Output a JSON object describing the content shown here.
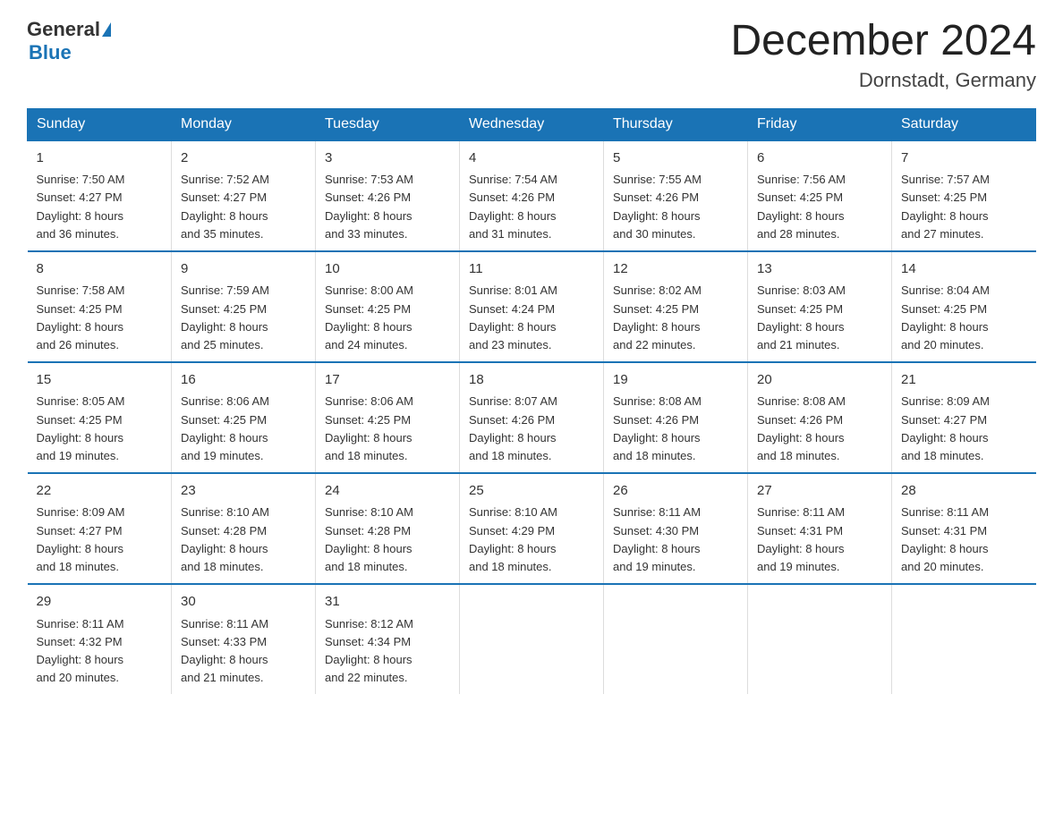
{
  "header": {
    "logo_general": "General",
    "logo_blue": "Blue",
    "month_title": "December 2024",
    "location": "Dornstadt, Germany"
  },
  "columns": [
    "Sunday",
    "Monday",
    "Tuesday",
    "Wednesday",
    "Thursday",
    "Friday",
    "Saturday"
  ],
  "weeks": [
    [
      {
        "day": "1",
        "sunrise": "7:50 AM",
        "sunset": "4:27 PM",
        "daylight": "8 hours and 36 minutes."
      },
      {
        "day": "2",
        "sunrise": "7:52 AM",
        "sunset": "4:27 PM",
        "daylight": "8 hours and 35 minutes."
      },
      {
        "day": "3",
        "sunrise": "7:53 AM",
        "sunset": "4:26 PM",
        "daylight": "8 hours and 33 minutes."
      },
      {
        "day": "4",
        "sunrise": "7:54 AM",
        "sunset": "4:26 PM",
        "daylight": "8 hours and 31 minutes."
      },
      {
        "day": "5",
        "sunrise": "7:55 AM",
        "sunset": "4:26 PM",
        "daylight": "8 hours and 30 minutes."
      },
      {
        "day": "6",
        "sunrise": "7:56 AM",
        "sunset": "4:25 PM",
        "daylight": "8 hours and 28 minutes."
      },
      {
        "day": "7",
        "sunrise": "7:57 AM",
        "sunset": "4:25 PM",
        "daylight": "8 hours and 27 minutes."
      }
    ],
    [
      {
        "day": "8",
        "sunrise": "7:58 AM",
        "sunset": "4:25 PM",
        "daylight": "8 hours and 26 minutes."
      },
      {
        "day": "9",
        "sunrise": "7:59 AM",
        "sunset": "4:25 PM",
        "daylight": "8 hours and 25 minutes."
      },
      {
        "day": "10",
        "sunrise": "8:00 AM",
        "sunset": "4:25 PM",
        "daylight": "8 hours and 24 minutes."
      },
      {
        "day": "11",
        "sunrise": "8:01 AM",
        "sunset": "4:24 PM",
        "daylight": "8 hours and 23 minutes."
      },
      {
        "day": "12",
        "sunrise": "8:02 AM",
        "sunset": "4:25 PM",
        "daylight": "8 hours and 22 minutes."
      },
      {
        "day": "13",
        "sunrise": "8:03 AM",
        "sunset": "4:25 PM",
        "daylight": "8 hours and 21 minutes."
      },
      {
        "day": "14",
        "sunrise": "8:04 AM",
        "sunset": "4:25 PM",
        "daylight": "8 hours and 20 minutes."
      }
    ],
    [
      {
        "day": "15",
        "sunrise": "8:05 AM",
        "sunset": "4:25 PM",
        "daylight": "8 hours and 19 minutes."
      },
      {
        "day": "16",
        "sunrise": "8:06 AM",
        "sunset": "4:25 PM",
        "daylight": "8 hours and 19 minutes."
      },
      {
        "day": "17",
        "sunrise": "8:06 AM",
        "sunset": "4:25 PM",
        "daylight": "8 hours and 18 minutes."
      },
      {
        "day": "18",
        "sunrise": "8:07 AM",
        "sunset": "4:26 PM",
        "daylight": "8 hours and 18 minutes."
      },
      {
        "day": "19",
        "sunrise": "8:08 AM",
        "sunset": "4:26 PM",
        "daylight": "8 hours and 18 minutes."
      },
      {
        "day": "20",
        "sunrise": "8:08 AM",
        "sunset": "4:26 PM",
        "daylight": "8 hours and 18 minutes."
      },
      {
        "day": "21",
        "sunrise": "8:09 AM",
        "sunset": "4:27 PM",
        "daylight": "8 hours and 18 minutes."
      }
    ],
    [
      {
        "day": "22",
        "sunrise": "8:09 AM",
        "sunset": "4:27 PM",
        "daylight": "8 hours and 18 minutes."
      },
      {
        "day": "23",
        "sunrise": "8:10 AM",
        "sunset": "4:28 PM",
        "daylight": "8 hours and 18 minutes."
      },
      {
        "day": "24",
        "sunrise": "8:10 AM",
        "sunset": "4:28 PM",
        "daylight": "8 hours and 18 minutes."
      },
      {
        "day": "25",
        "sunrise": "8:10 AM",
        "sunset": "4:29 PM",
        "daylight": "8 hours and 18 minutes."
      },
      {
        "day": "26",
        "sunrise": "8:11 AM",
        "sunset": "4:30 PM",
        "daylight": "8 hours and 19 minutes."
      },
      {
        "day": "27",
        "sunrise": "8:11 AM",
        "sunset": "4:31 PM",
        "daylight": "8 hours and 19 minutes."
      },
      {
        "day": "28",
        "sunrise": "8:11 AM",
        "sunset": "4:31 PM",
        "daylight": "8 hours and 20 minutes."
      }
    ],
    [
      {
        "day": "29",
        "sunrise": "8:11 AM",
        "sunset": "4:32 PM",
        "daylight": "8 hours and 20 minutes."
      },
      {
        "day": "30",
        "sunrise": "8:11 AM",
        "sunset": "4:33 PM",
        "daylight": "8 hours and 21 minutes."
      },
      {
        "day": "31",
        "sunrise": "8:12 AM",
        "sunset": "4:34 PM",
        "daylight": "8 hours and 22 minutes."
      },
      null,
      null,
      null,
      null
    ]
  ],
  "labels": {
    "sunrise": "Sunrise:",
    "sunset": "Sunset:",
    "daylight": "Daylight:"
  }
}
